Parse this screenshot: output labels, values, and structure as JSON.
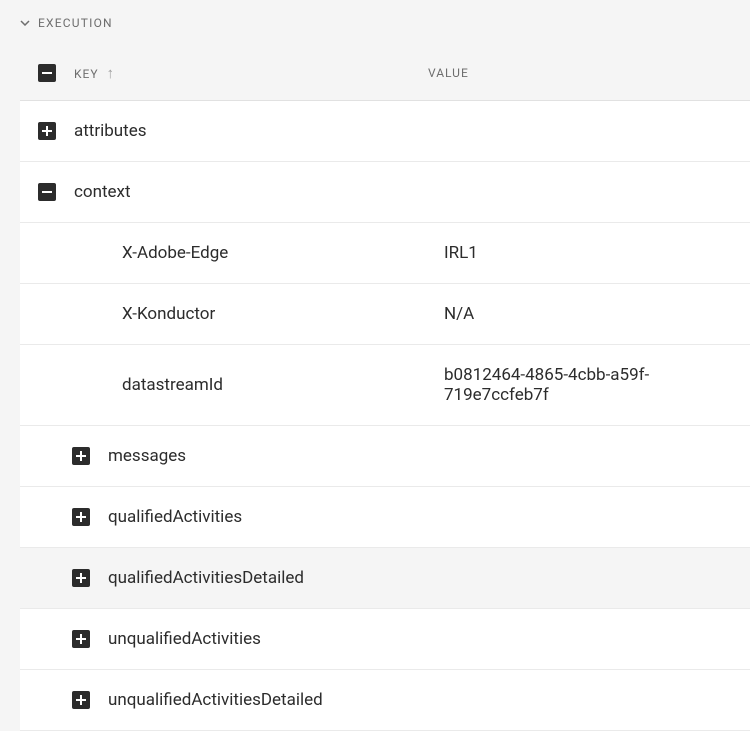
{
  "section": {
    "title": "EXECUTION"
  },
  "headers": {
    "key": "KEY",
    "value": "VALUE"
  },
  "rows": [
    {
      "key": "attributes",
      "value": "",
      "expandable": true,
      "expanded": false,
      "depth": 0,
      "selected": false
    },
    {
      "key": "context",
      "value": "",
      "expandable": true,
      "expanded": true,
      "depth": 0,
      "selected": false
    },
    {
      "key": "X-Adobe-Edge",
      "value": "IRL1",
      "expandable": false,
      "expanded": false,
      "depth": 2,
      "selected": false
    },
    {
      "key": "X-Konductor",
      "value": "N/A",
      "expandable": false,
      "expanded": false,
      "depth": 2,
      "selected": false
    },
    {
      "key": "datastreamId",
      "value": "b0812464-4865-4cbb-a59f-719e7ccfeb7f",
      "expandable": false,
      "expanded": false,
      "depth": 2,
      "selected": false
    },
    {
      "key": "messages",
      "value": "",
      "expandable": true,
      "expanded": false,
      "depth": 1,
      "selected": false
    },
    {
      "key": "qualifiedActivities",
      "value": "",
      "expandable": true,
      "expanded": false,
      "depth": 1,
      "selected": false
    },
    {
      "key": "qualifiedActivitiesDetailed",
      "value": "",
      "expandable": true,
      "expanded": false,
      "depth": 1,
      "selected": true
    },
    {
      "key": "unqualifiedActivities",
      "value": "",
      "expandable": true,
      "expanded": false,
      "depth": 1,
      "selected": false
    },
    {
      "key": "unqualifiedActivitiesDetailed",
      "value": "",
      "expandable": true,
      "expanded": false,
      "depth": 1,
      "selected": false
    }
  ]
}
